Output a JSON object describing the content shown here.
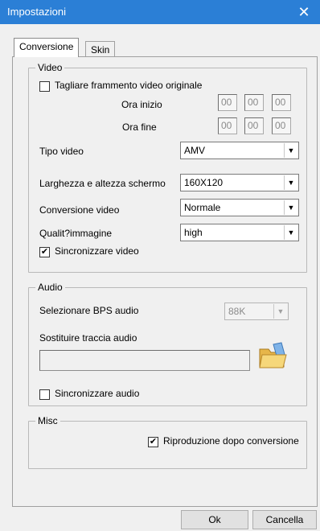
{
  "window": {
    "title": "Impostazioni",
    "close_glyph": "✕"
  },
  "tabs": [
    {
      "label": "Conversione"
    },
    {
      "label": "Skin"
    }
  ],
  "video": {
    "legend": "Video",
    "cut_label": "Tagliare frammento video originale",
    "cut_checked": false,
    "start_label": "Ora inizio",
    "end_label": "Ora fine",
    "start": [
      "00",
      "00",
      "00"
    ],
    "end": [
      "00",
      "00",
      "00"
    ],
    "type_label": "Tipo video",
    "type_value": "AMV",
    "size_label": "Larghezza e altezza schermo",
    "size_value": "160X120",
    "conv_label": "Conversione video",
    "conv_value": "Normale",
    "quality_label": "Qualit?immagine",
    "quality_value": "high",
    "sync_label": "Sincronizzare video",
    "sync_checked": true
  },
  "audio": {
    "legend": "Audio",
    "bps_label": "Selezionare BPS audio",
    "bps_value": "88K",
    "replace_label": "Sostituire traccia audio",
    "replace_value": "",
    "sync_label": "Sincronizzare audio",
    "sync_checked": false
  },
  "misc": {
    "legend": "Misc",
    "play_label": "Riproduzione dopo conversione",
    "play_checked": true
  },
  "buttons": {
    "ok": "Ok",
    "cancel": "Cancella"
  },
  "glyphs": {
    "check": "✔",
    "arrow": "▼"
  }
}
